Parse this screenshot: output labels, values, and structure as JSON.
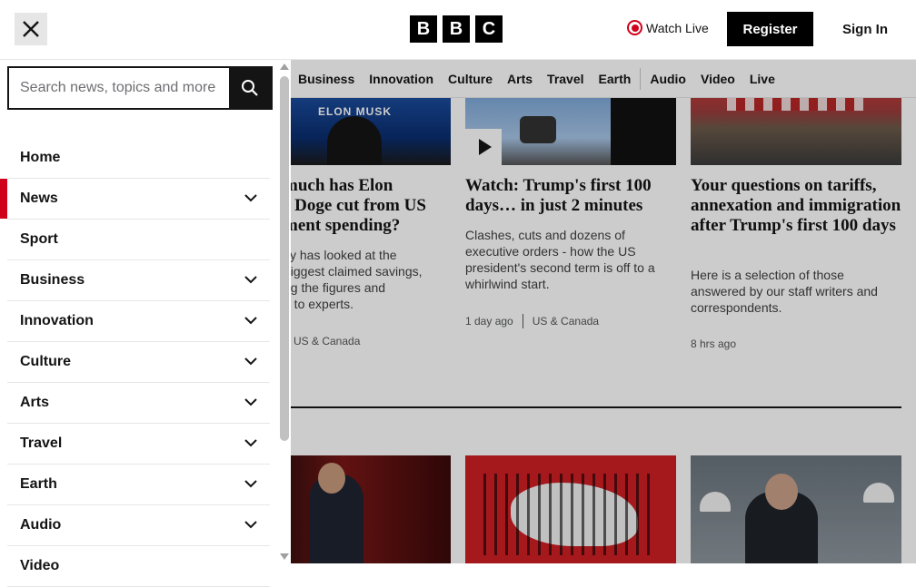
{
  "header": {
    "logo_letters": [
      "B",
      "B",
      "C"
    ],
    "watch_live": "Watch Live",
    "register": "Register",
    "sign_in": "Sign In"
  },
  "search": {
    "placeholder": "Search news, topics and more"
  },
  "menu": {
    "items": [
      {
        "label": "Home",
        "has_chevron": false,
        "active": false
      },
      {
        "label": "News",
        "has_chevron": true,
        "active": true
      },
      {
        "label": "Sport",
        "has_chevron": false,
        "active": false
      },
      {
        "label": "Business",
        "has_chevron": true,
        "active": false
      },
      {
        "label": "Innovation",
        "has_chevron": true,
        "active": false
      },
      {
        "label": "Culture",
        "has_chevron": true,
        "active": false
      },
      {
        "label": "Arts",
        "has_chevron": true,
        "active": false
      },
      {
        "label": "Travel",
        "has_chevron": true,
        "active": false
      },
      {
        "label": "Earth",
        "has_chevron": true,
        "active": false
      },
      {
        "label": "Audio",
        "has_chevron": true,
        "active": false
      },
      {
        "label": "Video",
        "has_chevron": false,
        "active": false
      }
    ]
  },
  "subnav": {
    "items": [
      "Business",
      "Innovation",
      "Culture",
      "Arts",
      "Travel",
      "Earth",
      "Audio",
      "Video",
      "Live"
    ]
  },
  "cards": [
    {
      "headline": "…much has Elon Musk's Doge cut from US government spending?",
      "headline_visible": "much has Elon\ns Doge cut from US\nment spending?",
      "summary": "ify has looked at the\nbiggest claimed savings,\nng the figures and\ng to experts.",
      "time": "",
      "tag": "US & Canada",
      "image_text": "ELON MUSK"
    },
    {
      "headline": "Watch: Trump's first 100 days… in just 2 minutes",
      "summary": "Clashes, cuts and dozens of executive orders - how the US president's second term is off to a whirlwind start.",
      "time": "1 day ago",
      "tag": "US & Canada"
    },
    {
      "headline": "Your questions on tariffs, annexation and immigration after Trump's first 100 days",
      "summary": "Here is a selection of those answered by our staff writers and correspondents.",
      "time": "8 hrs ago",
      "tag": ""
    }
  ],
  "colors": {
    "accent_red": "#d0021b",
    "black": "#141414"
  },
  "icons": {
    "close": "close-icon",
    "search": "search-icon",
    "chevron": "chevron-down-icon",
    "live": "live-dot-icon",
    "play": "play-icon"
  }
}
